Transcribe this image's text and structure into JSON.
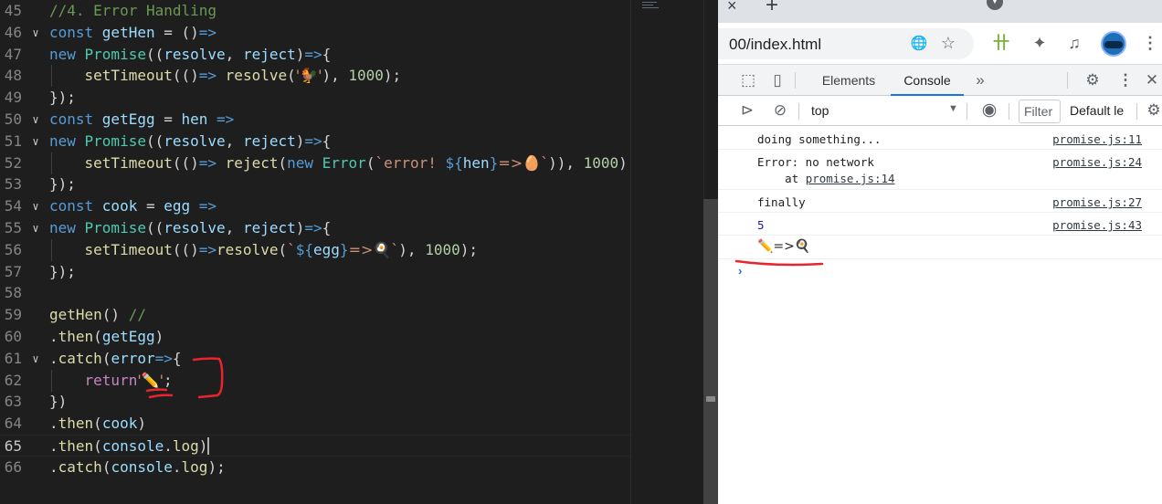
{
  "editor": {
    "lines": [
      {
        "n": "45",
        "fold": "",
        "tokens": [
          [
            "c-cmt",
            "//4. Error Handling"
          ]
        ]
      },
      {
        "n": "46",
        "fold": "∨",
        "tokens": [
          [
            "c-kw",
            "const "
          ],
          [
            "c-var",
            "getHen"
          ],
          [
            "c-pl",
            " = ()"
          ],
          [
            "c-punc",
            "=>"
          ]
        ]
      },
      {
        "n": "47",
        "fold": "",
        "tokens": [
          [
            "c-kw",
            "new "
          ],
          [
            "c-cls",
            "Promise"
          ],
          [
            "c-pl",
            "(("
          ],
          [
            "c-var",
            "resolve"
          ],
          [
            "c-pl",
            ", "
          ],
          [
            "c-var",
            "reject"
          ],
          [
            "c-pl",
            ")"
          ],
          [
            "c-punc",
            "=>"
          ],
          [
            "c-pl",
            "{"
          ]
        ]
      },
      {
        "n": "48",
        "fold": "",
        "guide": true,
        "tokens": [
          [
            "c-pl",
            "    "
          ],
          [
            "c-fn",
            "setTimeout"
          ],
          [
            "c-pl",
            "(()"
          ],
          [
            "c-punc",
            "=>"
          ],
          [
            "c-pl",
            " "
          ],
          [
            "c-fn",
            "resolve"
          ],
          [
            "c-pl",
            "("
          ],
          [
            "c-str",
            "'🐓'"
          ],
          [
            "c-pl",
            "), "
          ],
          [
            "c-num",
            "1000"
          ],
          [
            "c-pl",
            ");"
          ]
        ]
      },
      {
        "n": "49",
        "fold": "",
        "tokens": [
          [
            "c-pl",
            "});"
          ]
        ]
      },
      {
        "n": "50",
        "fold": "∨",
        "tokens": [
          [
            "c-kw",
            "const "
          ],
          [
            "c-var",
            "getEgg"
          ],
          [
            "c-pl",
            " = "
          ],
          [
            "c-var",
            "hen"
          ],
          [
            "c-pl",
            " "
          ],
          [
            "c-punc",
            "=>"
          ]
        ]
      },
      {
        "n": "51",
        "fold": "∨",
        "tokens": [
          [
            "c-kw",
            "new "
          ],
          [
            "c-cls",
            "Promise"
          ],
          [
            "c-pl",
            "(("
          ],
          [
            "c-var",
            "resolve"
          ],
          [
            "c-pl",
            ", "
          ],
          [
            "c-var",
            "reject"
          ],
          [
            "c-pl",
            ")"
          ],
          [
            "c-punc",
            "=>"
          ],
          [
            "c-pl",
            "{"
          ]
        ]
      },
      {
        "n": "52",
        "fold": "",
        "guide": true,
        "tokens": [
          [
            "c-pl",
            "    "
          ],
          [
            "c-fn",
            "setTimeout"
          ],
          [
            "c-pl",
            "(()"
          ],
          [
            "c-punc",
            "=>"
          ],
          [
            "c-pl",
            " "
          ],
          [
            "c-fn",
            "reject"
          ],
          [
            "c-pl",
            "("
          ],
          [
            "c-kw",
            "new "
          ],
          [
            "c-cls",
            "Error"
          ],
          [
            "c-pl",
            "("
          ],
          [
            "c-str",
            "`error! "
          ],
          [
            "c-kw",
            "${"
          ],
          [
            "c-var",
            "hen"
          ],
          [
            "c-kw",
            "}"
          ],
          [
            "c-str",
            "=>🥚`"
          ],
          [
            "c-pl",
            ")), "
          ],
          [
            "c-num",
            "1000"
          ],
          [
            "c-pl",
            ");"
          ]
        ]
      },
      {
        "n": "53",
        "fold": "",
        "tokens": [
          [
            "c-pl",
            "});"
          ]
        ]
      },
      {
        "n": "54",
        "fold": "∨",
        "tokens": [
          [
            "c-kw",
            "const "
          ],
          [
            "c-var",
            "cook"
          ],
          [
            "c-pl",
            " = "
          ],
          [
            "c-var",
            "egg"
          ],
          [
            "c-pl",
            " "
          ],
          [
            "c-punc",
            "=>"
          ]
        ]
      },
      {
        "n": "55",
        "fold": "∨",
        "tokens": [
          [
            "c-kw",
            "new "
          ],
          [
            "c-cls",
            "Promise"
          ],
          [
            "c-pl",
            "(("
          ],
          [
            "c-var",
            "resolve"
          ],
          [
            "c-pl",
            ", "
          ],
          [
            "c-var",
            "reject"
          ],
          [
            "c-pl",
            ")"
          ],
          [
            "c-punc",
            "=>"
          ],
          [
            "c-pl",
            "{"
          ]
        ]
      },
      {
        "n": "56",
        "fold": "",
        "guide": true,
        "tokens": [
          [
            "c-pl",
            "    "
          ],
          [
            "c-fn",
            "setTimeout"
          ],
          [
            "c-pl",
            "(()"
          ],
          [
            "c-punc",
            "=>"
          ],
          [
            "c-fn",
            "resolve"
          ],
          [
            "c-pl",
            "("
          ],
          [
            "c-str",
            "`"
          ],
          [
            "c-kw",
            "${"
          ],
          [
            "c-var",
            "egg"
          ],
          [
            "c-kw",
            "}"
          ],
          [
            "c-str",
            "=>🍳`"
          ],
          [
            "c-pl",
            "), "
          ],
          [
            "c-num",
            "1000"
          ],
          [
            "c-pl",
            ");"
          ]
        ]
      },
      {
        "n": "57",
        "fold": "",
        "tokens": [
          [
            "c-pl",
            "});"
          ]
        ]
      },
      {
        "n": "58",
        "fold": "",
        "tokens": []
      },
      {
        "n": "59",
        "fold": "",
        "tokens": [
          [
            "c-fn",
            "getHen"
          ],
          [
            "c-pl",
            "() "
          ],
          [
            "c-cmt",
            "//"
          ]
        ]
      },
      {
        "n": "60",
        "fold": "",
        "tokens": [
          [
            "c-pl",
            "."
          ],
          [
            "c-fn",
            "then"
          ],
          [
            "c-pl",
            "("
          ],
          [
            "c-var",
            "getEgg"
          ],
          [
            "c-pl",
            ")"
          ]
        ]
      },
      {
        "n": "61",
        "fold": "∨",
        "tokens": [
          [
            "c-pl",
            "."
          ],
          [
            "c-fn",
            "catch"
          ],
          [
            "c-pl",
            "("
          ],
          [
            "c-var",
            "error"
          ],
          [
            "c-punc",
            "=>"
          ],
          [
            "c-pl",
            "{"
          ]
        ]
      },
      {
        "n": "62",
        "fold": "",
        "guide": true,
        "tokens": [
          [
            "c-pl",
            "    "
          ],
          [
            "c-kw2",
            "return"
          ],
          [
            "c-str",
            "'✏️'"
          ],
          [
            "c-pl",
            ";"
          ]
        ]
      },
      {
        "n": "63",
        "fold": "",
        "tokens": [
          [
            "c-pl",
            "})"
          ]
        ]
      },
      {
        "n": "64",
        "fold": "",
        "tokens": [
          [
            "c-pl",
            "."
          ],
          [
            "c-fn",
            "then"
          ],
          [
            "c-pl",
            "("
          ],
          [
            "c-var",
            "cook"
          ],
          [
            "c-pl",
            ")"
          ]
        ]
      },
      {
        "n": "65",
        "fold": "",
        "active": true,
        "tokens": [
          [
            "c-pl",
            "."
          ],
          [
            "c-fn",
            "then"
          ],
          [
            "c-pl",
            "("
          ],
          [
            "c-var",
            "console"
          ],
          [
            "c-pl",
            "."
          ],
          [
            "c-fn",
            "log"
          ],
          [
            "c-pl",
            ")"
          ]
        ]
      },
      {
        "n": "66",
        "fold": "",
        "tokens": [
          [
            "c-pl",
            "."
          ],
          [
            "c-fn",
            "catch"
          ],
          [
            "c-pl",
            "("
          ],
          [
            "c-var",
            "console"
          ],
          [
            "c-pl",
            "."
          ],
          [
            "c-fn",
            "log"
          ],
          [
            "c-pl",
            ");"
          ]
        ]
      }
    ]
  },
  "browser": {
    "tab_close": "×",
    "new_tab": "+",
    "url": "00/index.html",
    "devtools": {
      "tabs": [
        "Elements",
        "Console"
      ],
      "active_tab": "Console",
      "more": "»",
      "context": "top",
      "filter_placeholder": "Filter",
      "levels": "Default le"
    },
    "console": [
      {
        "text": "doing something...",
        "source": "promise.js:11"
      },
      {
        "text": "Error: no network",
        "text2_prefix": "    at ",
        "text2_link": "promise.js:14",
        "source": "promise.js:24"
      },
      {
        "text": "finally",
        "source": "promise.js:27"
      },
      {
        "text": "5",
        "source": "promise.js:43"
      },
      {
        "text": "✏️=>🍳",
        "source": ""
      }
    ],
    "prompt": "›"
  },
  "colors": {
    "annotation": "#e8252b",
    "accent": "#1a73e8"
  }
}
